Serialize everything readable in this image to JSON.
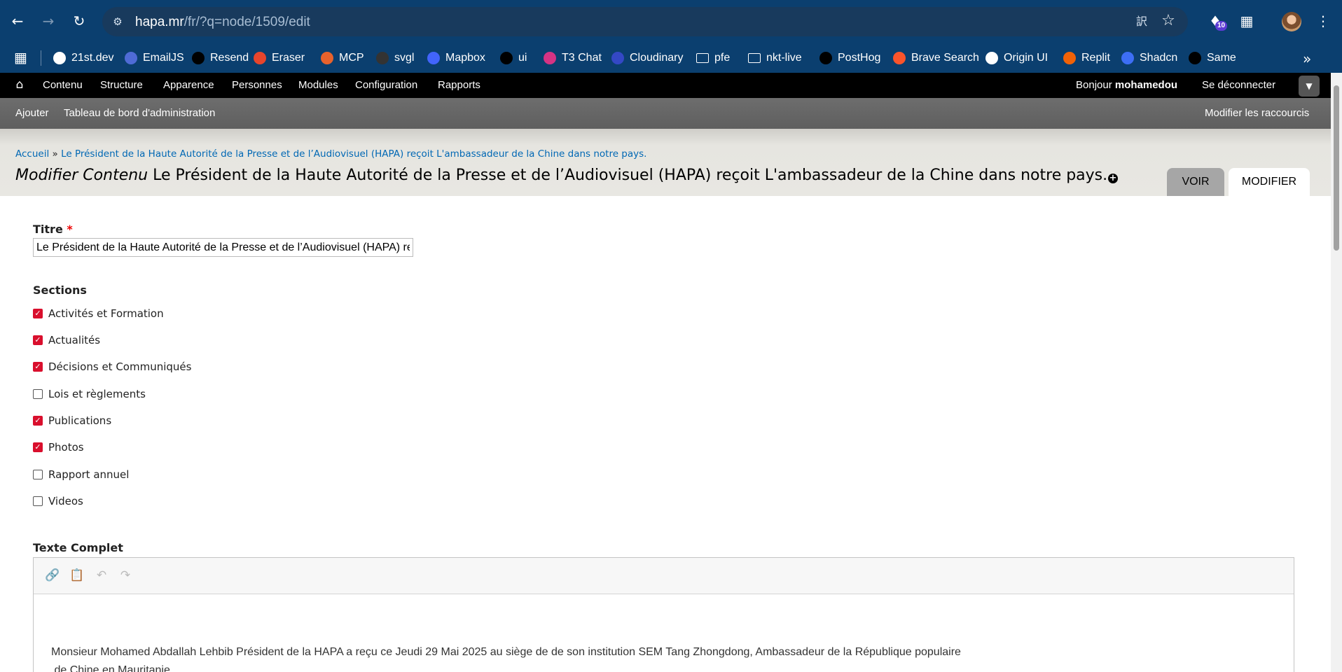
{
  "browser": {
    "url_host": "hapa.mr",
    "url_path": "/fr/?q=node/1509/edit",
    "back_icon": "arrow-left",
    "forward_icon": "arrow-right",
    "reload_icon": "reload",
    "extension_badge": "10"
  },
  "bookmarks": [
    {
      "label": "21st.dev",
      "color": "#ffffff"
    },
    {
      "label": "EmailJS",
      "color": "#4f6bd6"
    },
    {
      "label": "Resend",
      "color": "#000000"
    },
    {
      "label": "Eraser",
      "color": "#e8452c"
    },
    {
      "label": "MCP",
      "color": "#e8622c"
    },
    {
      "label": "svgl",
      "color": "#333333"
    },
    {
      "label": "Mapbox",
      "color": "#4264fb"
    },
    {
      "label": "ui",
      "color": "#000000"
    },
    {
      "label": "T3 Chat",
      "color": "#d63384"
    },
    {
      "label": "Cloudinary",
      "color": "#3448c5"
    },
    {
      "label": "pfe",
      "color": "folder"
    },
    {
      "label": "nkt-live",
      "color": "folder"
    },
    {
      "label": "PostHog",
      "color": "#000000"
    },
    {
      "label": "Brave Search",
      "color": "#fb542b"
    },
    {
      "label": "Origin UI",
      "color": "#ffffff"
    },
    {
      "label": "Replit",
      "color": "#f26207"
    },
    {
      "label": "Shadcn",
      "color": "#3d6ef5"
    },
    {
      "label": "Same",
      "color": "#000000"
    }
  ],
  "admin_menu": {
    "items": [
      "Contenu",
      "Structure",
      "Apparence",
      "Personnes",
      "Modules",
      "Configuration",
      "Rapports"
    ],
    "greeting": "Bonjour ",
    "username": "mohamedou",
    "logout": "Se déconnecter"
  },
  "shortcuts": {
    "items": [
      "Ajouter",
      "Tableau de bord d'administration"
    ],
    "edit": "Modifier les raccourcis"
  },
  "page": {
    "breadcrumb_home": "Accueil",
    "breadcrumb_sep": " » ",
    "breadcrumb_current": "Le Président de la Haute Autorité de la Presse et de l’Audiovisuel (HAPA) reçoit L'ambassadeur de la Chine dans notre pays.",
    "title_prefix": "Modifier Contenu",
    "title_text": " Le Président de la Haute Autorité de la Presse et de l’Audiovisuel (HAPA) reçoit L'ambassadeur de la Chine dans notre pays.",
    "tab_view": "VOIR",
    "tab_edit": "MODIFIER"
  },
  "form": {
    "title_label": "Titre",
    "required_mark": "*",
    "title_value": "Le Président de la Haute Autorité de la Presse et de l’Audiovisuel (HAPA) reçoit L'ambassadeur de la Chine dans notre pays.",
    "sections_label": "Sections",
    "sections": [
      {
        "label": "Activités et Formation",
        "checked": true
      },
      {
        "label": "Actualités",
        "checked": true
      },
      {
        "label": "Décisions et Communiqués",
        "checked": true
      },
      {
        "label": "Lois et règlements",
        "checked": false
      },
      {
        "label": "Publications",
        "checked": true
      },
      {
        "label": "Photos",
        "checked": true
      },
      {
        "label": "Rapport annuel",
        "checked": false
      },
      {
        "label": "Videos",
        "checked": false
      }
    ],
    "body_label": "Texte Complet",
    "body_line1": "Monsieur Mohamed Abdallah Lehbib Président de la HAPA a reçu ce Jeudi 29 Mai 2025 au siège de de son institution SEM Tang Zhongdong, Ambassadeur de la République populaire",
    "body_line2": " de Chine en Mauritanie"
  },
  "colors": {
    "chrome": "#0b3f6f",
    "checkbox_checked": "#d90f2d",
    "link": "#0068b4"
  }
}
